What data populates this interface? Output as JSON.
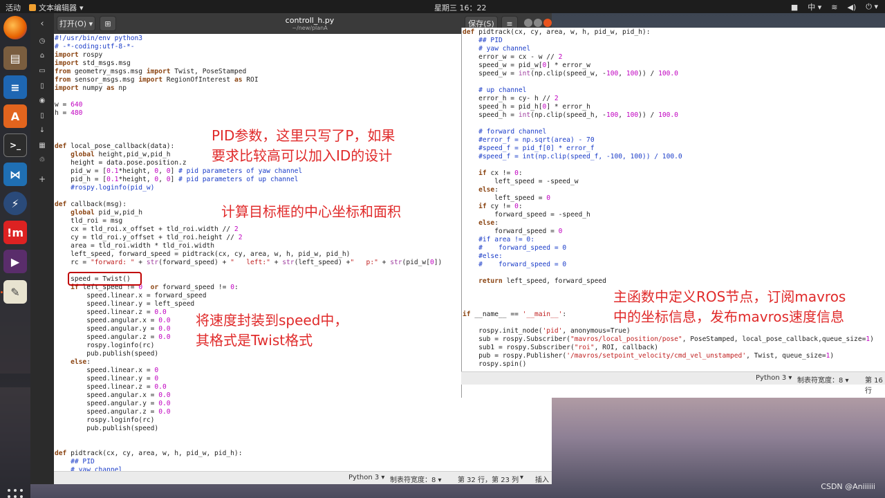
{
  "topbar": {
    "activities": "活动",
    "app": "文本编辑器",
    "clock": "星期三 16：22",
    "lang": "中",
    "tray_icons": [
      "camera-icon",
      "language-indicator",
      "network-icon",
      "volume-icon",
      "power-icon"
    ]
  },
  "window": {
    "open_button": "打开(O)",
    "title": "controll_h.py",
    "path": "~/new/planA",
    "save_button": "保存(S)",
    "menu_icon": "≡"
  },
  "code_main": [
    "#!/usr/bin/env python3",
    "# -*-coding:utf-8-*-",
    "import rospy",
    "import std_msgs.msg",
    "from geometry_msgs.msg import Twist, PoseStamped",
    "from sensor_msgs.msg import RegionOfInterest as ROI",
    "import numpy as np",
    "",
    "w = 640",
    "h = 480",
    "",
    "",
    "",
    "def local_pose_callback(data):",
    "    global height,pid_w,pid_h",
    "    height = data.pose.position.z",
    "    pid_w = [0.1*height, 0, 0] # pid parameters of yaw channel",
    "    pid_h = [0.1*height, 0, 0] # pid parameters of up channel",
    "    #rospy.loginfo(pid_w)",
    "",
    "def callback(msg):",
    "    global pid_w,pid_h",
    "    tld_roi = msg",
    "    cx = tld_roi.x_offset + tld_roi.width // 2",
    "    cy = tld_roi.y_offset + tld_roi.height // 2",
    "    area = tld_roi.width * tld_roi.width",
    "    left_speed, forward_speed = pidtrack(cx, cy, area, w, h, pid_w, pid_h)",
    "    rc = \"forward: \" + str(forward_speed) + \"   left:\" + str(left_speed) +\"   p:\" + str(pid_w[0])",
    "",
    "    speed = Twist()",
    "    if left_speed != 0  or forward_speed != 0:",
    "        speed.linear.x = forward_speed",
    "        speed.linear.y = left_speed",
    "        speed.linear.z = 0.0",
    "        speed.angular.x = 0.0",
    "        speed.angular.y = 0.0",
    "        speed.angular.z = 0.0",
    "        rospy.loginfo(rc)",
    "        pub.publish(speed)",
    "    else:",
    "        speed.linear.x = 0",
    "        speed.linear.y = 0",
    "        speed.linear.z = 0.0",
    "        speed.angular.x = 0.0",
    "        speed.angular.y = 0.0",
    "        speed.angular.z = 0.0",
    "        rospy.loginfo(rc)",
    "        pub.publish(speed)",
    "",
    "",
    "def pidtrack(cx, cy, area, w, h, pid_w, pid_h):",
    "    ## PID",
    "    # yaw channel",
    "    error_w = cx - w // 2"
  ],
  "code_right": [
    "def pidtrack(cx, cy, area, w, h, pid_w, pid_h):",
    "    ## PID",
    "    # yaw channel",
    "    error_w = cx - w // 2",
    "    speed_w = pid_w[0] * error_w",
    "    speed_w = int(np.clip(speed_w, -100, 100)) / 100.0",
    "",
    "    # up channel",
    "    error_h = cy- h // 2",
    "    speed_h = pid_h[0] * error_h",
    "    speed_h = int(np.clip(speed_h, -100, 100)) / 100.0",
    "",
    "    # forward channel",
    "    #error_f = np.sqrt(area) - 70",
    "    #speed_f = pid_f[0] * error_f",
    "    #speed_f = int(np.clip(speed_f, -100, 100)) / 100.0",
    "",
    "    if cx != 0:",
    "        left_speed = -speed_w",
    "    else:",
    "        left_speed = 0",
    "    if cy != 0:",
    "        forward_speed = -speed_h",
    "    else:",
    "        forward_speed = 0",
    "    #if area != 0:",
    "    #    forward_speed = 0",
    "    #else:",
    "    #    forward_speed = 0",
    "",
    "    return left_speed, forward_speed",
    "",
    "",
    "",
    "if __name__ == '__main__':",
    "",
    "    rospy.init_node('pid', anonymous=True)",
    "    sub = rospy.Subscriber(\"mavros/local_position/pose\", PoseStamped, local_pose_callback,queue_size=1)",
    "    sub1 = rospy.Subscriber(\"roi\", ROI, callback)",
    "    pub = rospy.Publisher('/mavros/setpoint_velocity/cmd_vel_unstamped', Twist, queue_size=1)",
    "    rospy.spin()"
  ],
  "statusbar_main": {
    "language": "Python 3 ▾",
    "tab_width": "制表符宽度：8 ▾",
    "position": "第 32 行，第 23 列",
    "mode": "插入"
  },
  "statusbar_right": {
    "language": "Python 3 ▾",
    "tab_width": "制表符宽度：8 ▾",
    "position": "第 16 行"
  },
  "annotations": {
    "pid_note_1": "PID参数，这里只写了P，如果",
    "pid_note_2": "要求比较高可以加入ID的设计",
    "center_note": "计算目标框的中心坐标和面积",
    "speed_note_1": "将速度封装到speed中，",
    "speed_note_2": "其格式是Twist格式",
    "main_note_1": "主函数中定义ROS节点，订阅mavros",
    "main_note_2": "中的坐标信息，发布mavros速度信息"
  },
  "watermark": "CSDN @Aniiiiii",
  "colors": {
    "annotation": "#e02a2a",
    "highlight_box": "#c00000",
    "keyword": "#8b4513",
    "string": "#c02020",
    "comment": "#1a3cc8",
    "number": "#c000c0"
  }
}
